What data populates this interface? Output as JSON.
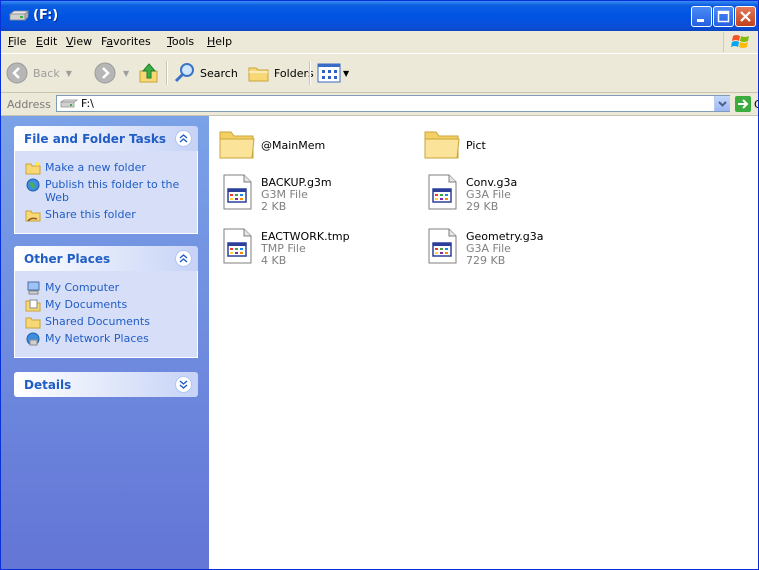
{
  "window": {
    "title": "(F:)",
    "icon": "drive-icon",
    "controls": [
      "minimize",
      "maximize",
      "close"
    ]
  },
  "menu": {
    "file": {
      "accel": "F",
      "rest": "ile"
    },
    "edit": {
      "accel": "E",
      "rest": "dit"
    },
    "view": {
      "accel": "V",
      "rest": "iew"
    },
    "favorites": {
      "pre": "F",
      "accel": "a",
      "rest": "vorites"
    },
    "tools": {
      "accel": "T",
      "rest": "ools"
    },
    "help": {
      "accel": "H",
      "rest": "elp"
    }
  },
  "toolbar": {
    "back_label": "Back",
    "search_label": "Search",
    "folders_label": "Folders"
  },
  "address": {
    "label": "Address",
    "value": "F:\\",
    "go_label": "Go"
  },
  "panels": {
    "tasks": {
      "title": "File and Folder Tasks",
      "items": [
        {
          "label": "Make a new folder",
          "icon": "new-folder-icon"
        },
        {
          "label": "Publish this folder to the Web",
          "icon": "publish-web-icon"
        },
        {
          "label": "Share this folder",
          "icon": "share-folder-icon"
        }
      ]
    },
    "places": {
      "title": "Other Places",
      "items": [
        {
          "label": "My Computer",
          "icon": "my-computer-icon"
        },
        {
          "label": "My Documents",
          "icon": "my-documents-icon"
        },
        {
          "label": "Shared Documents",
          "icon": "shared-documents-icon"
        },
        {
          "label": "My Network Places",
          "icon": "network-places-icon"
        }
      ]
    },
    "details": {
      "title": "Details"
    }
  },
  "files": [
    {
      "name": "@MainMem",
      "kind": "folder"
    },
    {
      "name": "Pict",
      "kind": "folder"
    },
    {
      "name": "BACKUP.g3m",
      "type": "G3M File",
      "size": "2 KB",
      "kind": "file"
    },
    {
      "name": "Conv.g3a",
      "type": "G3A File",
      "size": "29 KB",
      "kind": "file"
    },
    {
      "name": "EACTWORK.tmp",
      "type": "TMP File",
      "size": "4 KB",
      "kind": "file"
    },
    {
      "name": "Geometry.g3a",
      "type": "G3A File",
      "size": "729 KB",
      "kind": "file"
    }
  ],
  "colors": {
    "titlebar": "#0054e3",
    "task_link": "#215dc6",
    "task_pane": "#7ba2e7",
    "close_button": "#c2411c"
  }
}
